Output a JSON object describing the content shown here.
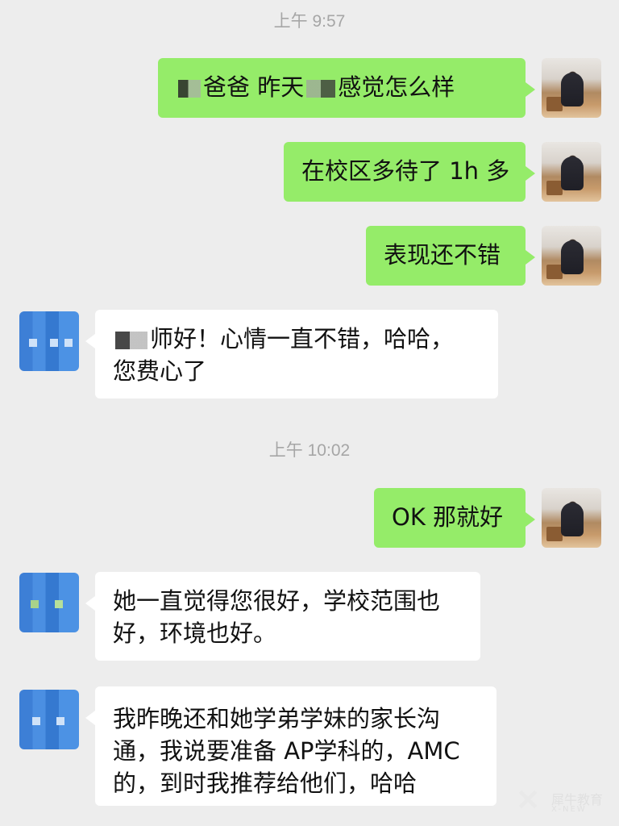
{
  "timestamps": [
    "上午 9:57",
    "上午 10:02"
  ],
  "messages": [
    {
      "side": "mine",
      "text_1": "爸爸 昨天",
      "text_2": "感觉怎么样"
    },
    {
      "side": "mine",
      "text": "在校区多待了 1h 多"
    },
    {
      "side": "mine",
      "text": "表现还不错"
    },
    {
      "side": "theirs",
      "line1": "师好！心情一直不错，哈哈，",
      "line2": "您费心了"
    },
    {
      "side": "mine",
      "text": "OK 那就好"
    },
    {
      "side": "theirs",
      "line1": "她一直觉得您很好，学校范围也",
      "line2": "好，环境也好。"
    },
    {
      "side": "theirs",
      "line1": "我昨晚还和她学弟学妹的家长沟",
      "line2": "通，我说要准备 AP学科的，AMC",
      "line3": "的，到时我推荐给他们，哈哈"
    }
  ],
  "avatars": {
    "self": "teacher-photo-avatar",
    "other": "blurred-blue-avatar"
  },
  "colors": {
    "mine_bubble": "#95ec69",
    "theirs_bubble": "#ffffff",
    "background": "#ededed"
  },
  "watermark": {
    "cn": "犀牛教育",
    "en": "X-NEW"
  }
}
